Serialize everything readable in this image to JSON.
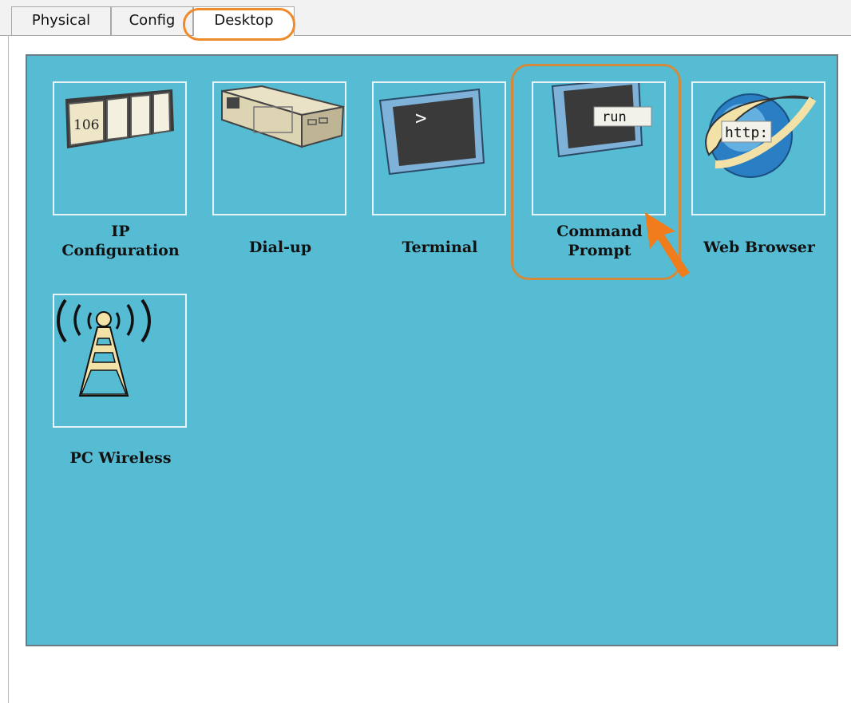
{
  "tabs": [
    "Physical",
    "Config",
    "Desktop"
  ],
  "active_tab": "Desktop",
  "desktop": {
    "background_color": "#55bcd4",
    "apps": [
      {
        "label_line1": "IP",
        "label_line2": "Configuration",
        "icon": "ip-configuration-icon",
        "icon_text": "106"
      },
      {
        "label_line1": "Dial-up",
        "label_line2": "",
        "icon": "dialup-modem-icon"
      },
      {
        "label_line1": "Terminal",
        "label_line2": "",
        "icon": "terminal-monitor-icon",
        "icon_text": ">"
      },
      {
        "label_line1": "Command",
        "label_line2": "Prompt",
        "icon": "command-prompt-icon",
        "icon_text": "run"
      },
      {
        "label_line1": "Web Browser",
        "label_line2": "",
        "icon": "web-browser-icon",
        "icon_text": "http:"
      },
      {
        "label_line1": "PC Wireless",
        "label_line2": "",
        "icon": "wireless-tower-icon"
      }
    ]
  },
  "annotations": {
    "highlight_color": "#ef8a2a"
  }
}
